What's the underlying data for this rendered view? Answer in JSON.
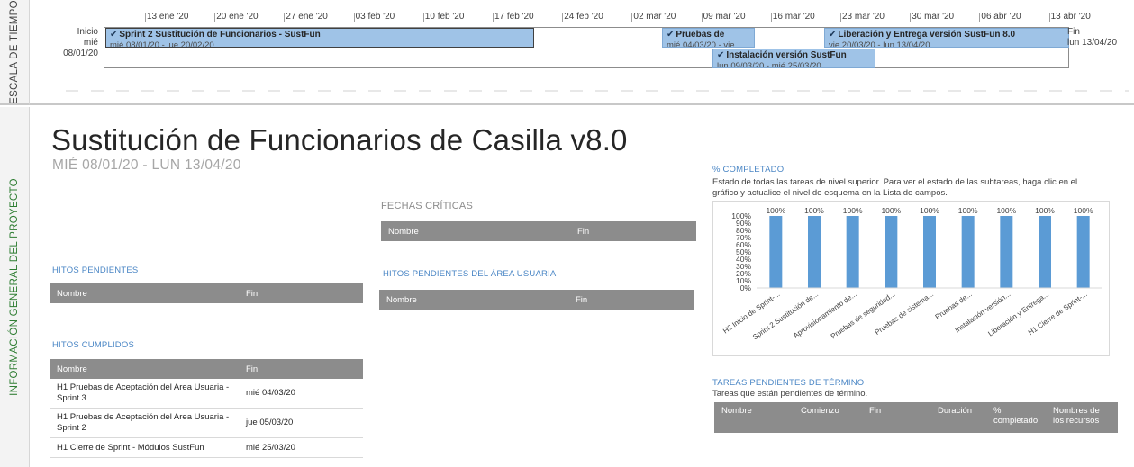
{
  "side_labels": {
    "timescale": "ESCALA DE TIEMPO",
    "overview": "INFORMACIÓN GENERAL DEL PROYECTO"
  },
  "timeline": {
    "ticks": [
      "13 ene '20",
      "20 ene '20",
      "27 ene '20",
      "03 feb '20",
      "10 feb '20",
      "17 feb '20",
      "24 feb '20",
      "02 mar '20",
      "09 mar '20",
      "16 mar '20",
      "23 mar '20",
      "30 mar '20",
      "06 abr '20",
      "13 abr '20"
    ],
    "start_label": "Inicio",
    "start_date": "mié 08/01/20",
    "end_label": "Fin",
    "end_date": "lun 13/04/20",
    "bars": [
      {
        "title": "Sprint 2 Sustitución de Funcionarios - SustFun",
        "dates": "mié 08/01/20 - jue 20/02/20"
      },
      {
        "title": "Pruebas de",
        "dates": "mié 04/03/20 - vie"
      },
      {
        "title": "Liberación y Entrega versión SustFun 8.0",
        "dates": "vie 20/03/20 - lun 13/04/20"
      },
      {
        "title": "Instalación versión SustFun",
        "dates": "lun 09/03/20 - mié 25/03/20"
      }
    ]
  },
  "project": {
    "title": "Sustitución de Funcionarios de Casilla v8.0",
    "dates": "MIÉ 08/01/20 -  LUN 13/04/20"
  },
  "critical_dates": {
    "heading": "FECHAS CRÍTICAS",
    "col_name": "Nombre",
    "col_end": "Fin"
  },
  "pending_milestones": {
    "heading": "HITOS PENDIENTES",
    "col_name": "Nombre",
    "col_end": "Fin"
  },
  "pending_user_milestones": {
    "heading": "HITOS PENDIENTES DEL ÁREA USUARIA",
    "col_name": "Nombre",
    "col_end": "Fin"
  },
  "completed_milestones": {
    "heading": "HITOS CUMPLIDOS",
    "col_name": "Nombre",
    "col_end": "Fin",
    "rows": [
      {
        "name": "H1 Pruebas de Aceptación del Area Usuaria - Sprint 3",
        "end": "mié 04/03/20"
      },
      {
        "name": "H1 Pruebas de Aceptación del Area Usuaria - Sprint 2",
        "end": "jue 05/03/20"
      },
      {
        "name": "H1 Cierre de Sprint - Módulos SustFun",
        "end": "mié 25/03/20"
      }
    ]
  },
  "percent_complete": {
    "heading": "% COMPLETADO",
    "description": "Estado de todas las tareas de nivel superior. Para ver el estado de las subtareas, haga clic en el gráfico y actualice el nivel de esquema en la Lista de campos."
  },
  "chart_data": {
    "type": "bar",
    "categories": [
      "H2 Inicio de Sprint-...",
      "Sprint 2 Sustitución de...",
      "Aprovisionamiento de...",
      "Pruebas de seguridad...",
      "Pruebas de sistema...",
      "Pruebas de...",
      "Instalación versión...",
      "Liberación y Entrega...",
      "H1 Cierre de Sprint-..."
    ],
    "values": [
      100,
      100,
      100,
      100,
      100,
      100,
      100,
      100,
      100
    ],
    "data_labels": [
      "100%",
      "100%",
      "100%",
      "100%",
      "100%",
      "100%",
      "100%",
      "100%",
      "100%"
    ],
    "y_ticks": [
      "0%",
      "10%",
      "20%",
      "30%",
      "40%",
      "50%",
      "60%",
      "70%",
      "80%",
      "90%",
      "100%"
    ],
    "ylim": [
      0,
      100
    ],
    "grid": false,
    "bar_color": "#5b9bd5"
  },
  "pending_tasks": {
    "heading": "TAREAS PENDIENTES DE TÉRMINO",
    "description": "Tareas que están pendientes de término.",
    "columns": [
      "Nombre",
      "Comienzo",
      "Fin",
      "Duración",
      "% completado",
      "Nombres de los recursos"
    ]
  },
  "colors": {
    "accent_blue": "#4a86c5",
    "bar_blue": "#9fc3e7",
    "header_gray": "#8c8c8c",
    "overview_green": "#2e7d32"
  }
}
